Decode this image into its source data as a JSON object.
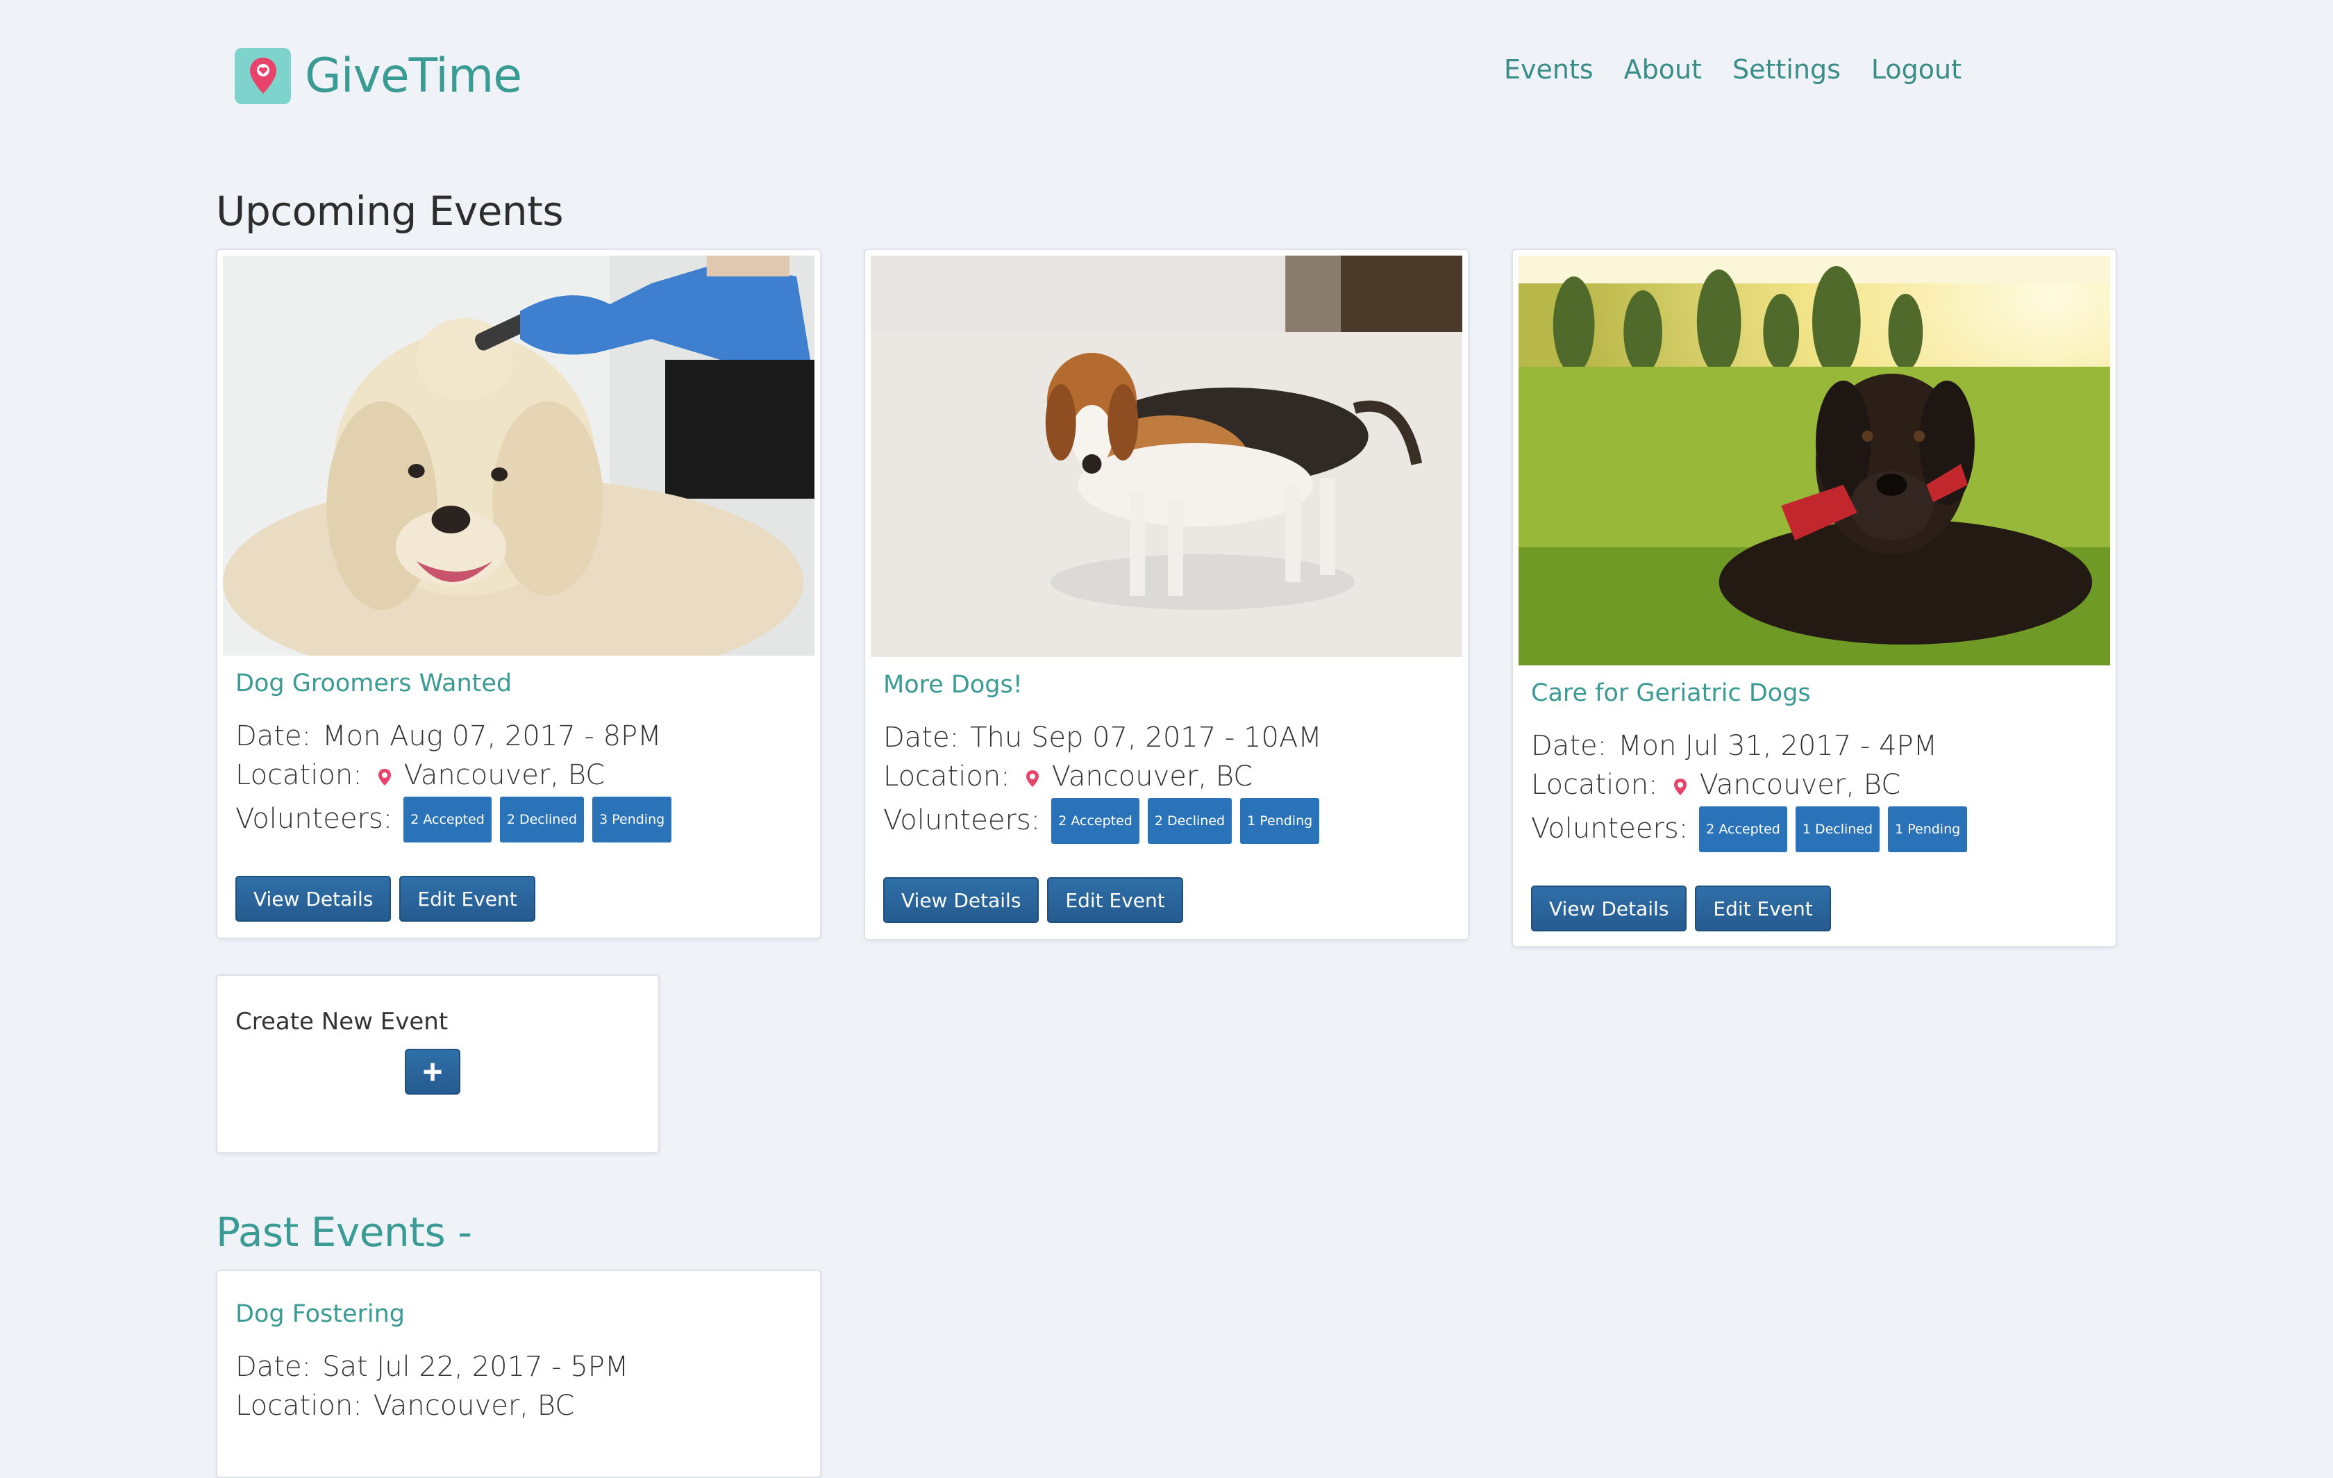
{
  "brand": {
    "name": "GiveTime",
    "logo_icon": "map-pin-icon",
    "logo_color": "#7fd3cd",
    "text_color": "#3a9a94"
  },
  "nav": {
    "items": [
      "Events",
      "About",
      "Settings",
      "Logout"
    ]
  },
  "upcoming": {
    "title": "Upcoming Events",
    "events": [
      {
        "title": "Dog Groomers Wanted",
        "image": "golden-retriever-grooming",
        "date_label": "Date:",
        "date": "Mon Aug 07, 2017 - 8PM",
        "location_label": "Location:",
        "location": "Vancouver, BC",
        "volunteers_label": "Volunteers:",
        "badges": [
          "2 Accepted",
          "2 Declined",
          "3 Pending"
        ],
        "view_label": "View Details",
        "edit_label": "Edit Event"
      },
      {
        "title": "More Dogs!",
        "image": "beagle-on-floor",
        "date_label": "Date:",
        "date": "Thu Sep 07, 2017 - 10AM",
        "location_label": "Location:",
        "location": "Vancouver, BC",
        "volunteers_label": "Volunteers:",
        "badges": [
          "2 Accepted",
          "2 Declined",
          "1 Pending"
        ],
        "view_label": "View Details",
        "edit_label": "Edit Event"
      },
      {
        "title": "Care for Geriatric Dogs",
        "image": "black-labrador-in-grass",
        "date_label": "Date:",
        "date": "Mon Jul 31, 2017 - 4PM",
        "location_label": "Location:",
        "location": "Vancouver, BC",
        "volunteers_label": "Volunteers:",
        "badges": [
          "2 Accepted",
          "1 Declined",
          "1 Pending"
        ],
        "view_label": "View Details",
        "edit_label": "Edit Event"
      }
    ]
  },
  "create": {
    "label": "Create New Event",
    "button": "+"
  },
  "past": {
    "title": "Past Events -",
    "events": [
      {
        "title": "Dog Fostering",
        "date_label": "Date:",
        "date": "Sat Jul 22, 2017 - 5PM",
        "location_label": "Location:",
        "location": "Vancouver, BC"
      }
    ]
  },
  "colors": {
    "accent": "#3a9a94",
    "button": "#2a6aa3",
    "badge": "#2a73b8",
    "pin": "#e8436b",
    "background": "#eff3f8"
  }
}
